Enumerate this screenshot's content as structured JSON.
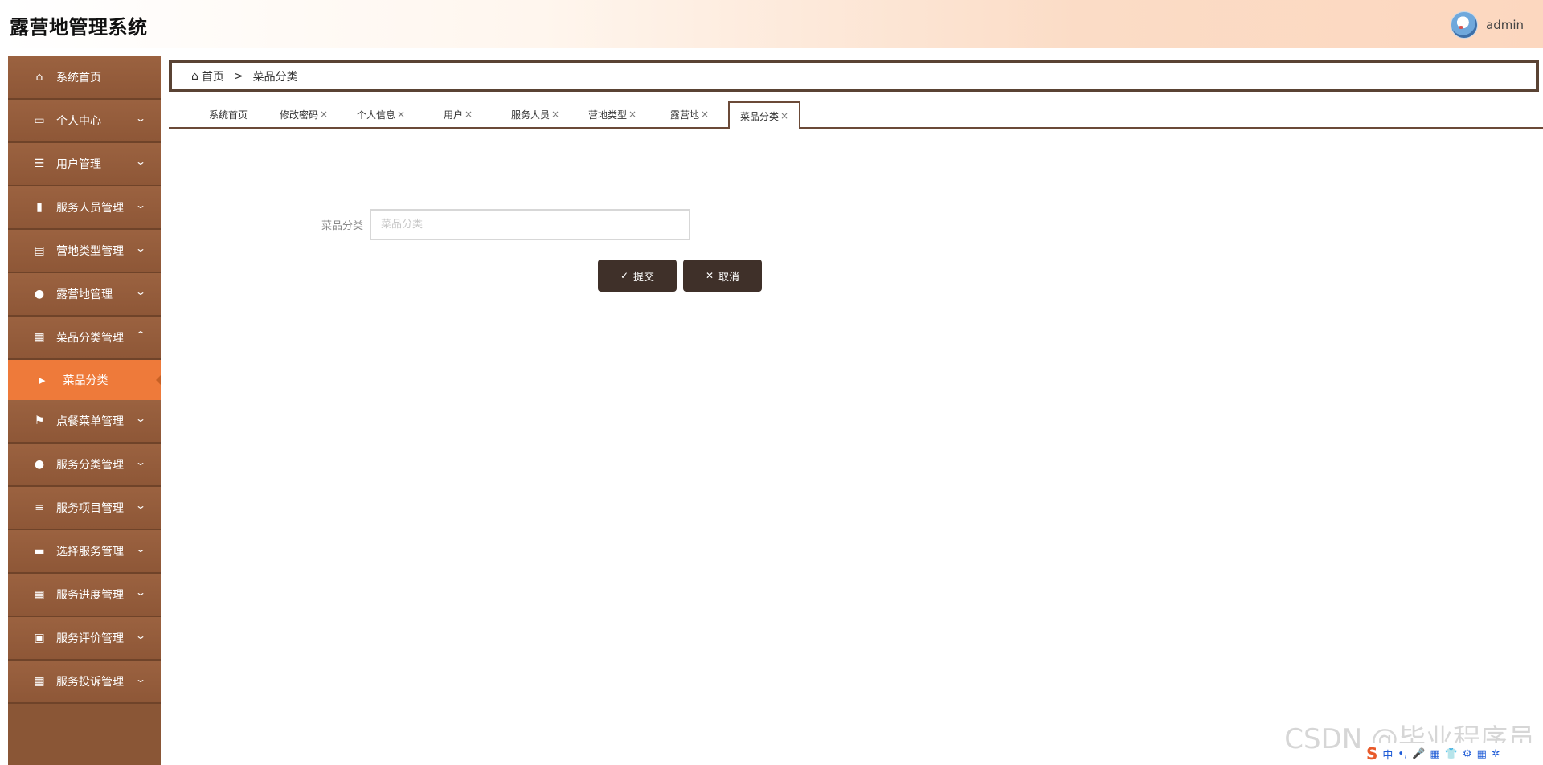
{
  "app": {
    "title": "露营地管理系统"
  },
  "user": {
    "name": "admin"
  },
  "sidebar": {
    "items": [
      {
        "label": "系统首页",
        "icon": "home-icon",
        "glyph": "⌂",
        "arrow": ""
      },
      {
        "label": "个人中心",
        "icon": "card-icon",
        "glyph": "▭",
        "arrow": "⌄"
      },
      {
        "label": "用户管理",
        "icon": "sliders-icon",
        "glyph": "☰",
        "arrow": "⌄"
      },
      {
        "label": "服务人员管理",
        "icon": "bar-chart-icon",
        "glyph": "▮",
        "arrow": "⌄"
      },
      {
        "label": "营地类型管理",
        "icon": "trend-chart-icon",
        "glyph": "▤",
        "arrow": "⌄"
      },
      {
        "label": "露营地管理",
        "icon": "person-icon",
        "glyph": "●",
        "arrow": "⌄"
      },
      {
        "label": "菜品分类管理",
        "icon": "grid-icon",
        "glyph": "▦",
        "arrow": "⌃"
      }
    ],
    "active_sub": {
      "label": "菜品分类",
      "icon": "caret-right-icon",
      "glyph": "▶"
    },
    "items_after": [
      {
        "label": "点餐菜单管理",
        "icon": "flag-icon",
        "glyph": "⚑",
        "arrow": "⌄"
      },
      {
        "label": "服务分类管理",
        "icon": "bulb-icon",
        "glyph": "●",
        "arrow": "⌄"
      },
      {
        "label": "服务项目管理",
        "icon": "list-icon",
        "glyph": "≡",
        "arrow": "⌄"
      },
      {
        "label": "选择服务管理",
        "icon": "message-icon",
        "glyph": "▬",
        "arrow": "⌄"
      },
      {
        "label": "服务进度管理",
        "icon": "grid-icon",
        "glyph": "▦",
        "arrow": "⌄"
      },
      {
        "label": "服务评价管理",
        "icon": "clipboard-icon",
        "glyph": "▣",
        "arrow": "⌄"
      },
      {
        "label": "服务投诉管理",
        "icon": "grid-icon",
        "glyph": "▦",
        "arrow": "⌄"
      }
    ]
  },
  "breadcrumb": {
    "home": "首页",
    "separator": ">",
    "current": "菜品分类"
  },
  "tabs": [
    {
      "label": "系统首页",
      "close": ""
    },
    {
      "label": "修改密码",
      "close": "×"
    },
    {
      "label": "个人信息",
      "close": "×"
    },
    {
      "label": "用户",
      "close": "×"
    },
    {
      "label": "服务人员",
      "close": "×"
    },
    {
      "label": "营地类型",
      "close": "×"
    },
    {
      "label": "露营地",
      "close": "×"
    },
    {
      "label": "菜品分类",
      "close": "×"
    }
  ],
  "form": {
    "label": "菜品分类",
    "placeholder": "菜品分类",
    "value": "",
    "submit_label": "提交",
    "cancel_label": "取消"
  },
  "watermark": "CSDN @毕业程序员",
  "ime": {
    "logo": "S",
    "items": [
      "中",
      "•,",
      "🎤",
      "▦",
      "👕",
      "⚙",
      "▦",
      "✲"
    ]
  },
  "colors": {
    "sidebar_bg": "#8a5636",
    "active_item": "#ee7a3a",
    "button_bg": "#3f3029",
    "border_dark": "#5a4334"
  }
}
